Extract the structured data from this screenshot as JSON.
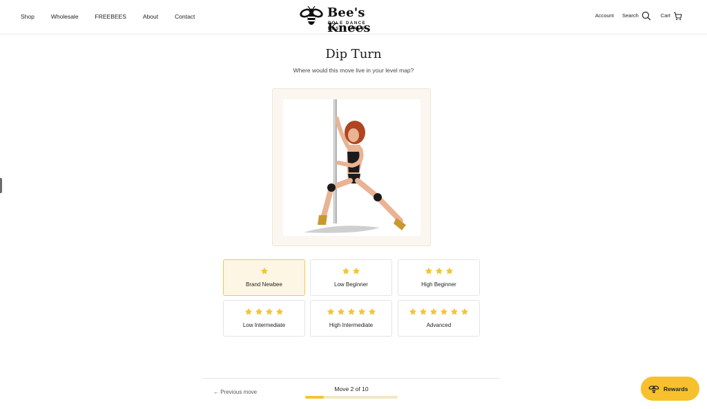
{
  "header": {
    "nav": [
      "Shop",
      "Wholesale",
      "FREEBEES",
      "About",
      "Contact"
    ],
    "brand_name": "Bee's Knees",
    "brand_tagline": "POLE DANCE ESSENTIALS",
    "account_label": "Account",
    "search_label": "Search",
    "cart_label": "Cart"
  },
  "main": {
    "title": "Dip Turn",
    "subtitle": "Where would this move live in your level map?",
    "image_icon": "pole-dancer-illustration",
    "levels": [
      {
        "stars": 1,
        "label": "Brand Newbee",
        "selected": true
      },
      {
        "stars": 2,
        "label": "Low Beginner",
        "selected": false
      },
      {
        "stars": 3,
        "label": "High Beginner",
        "selected": false
      },
      {
        "stars": 4,
        "label": "Low Intermediate",
        "selected": false
      },
      {
        "stars": 5,
        "label": "High Intermediate",
        "selected": false
      },
      {
        "stars": 6,
        "label": "Advanced",
        "selected": false
      }
    ]
  },
  "footer": {
    "prev_label": "← Previous move",
    "move_count": "Move 2 of 10",
    "progress": 0.2
  },
  "rewards": {
    "label": "Rewards",
    "icon": "bee-icon"
  },
  "colors": {
    "accent": "#f5c332",
    "star": "#f5c332",
    "selected_bg": "#fdf6e4",
    "selected_border": "#f4c64b"
  }
}
